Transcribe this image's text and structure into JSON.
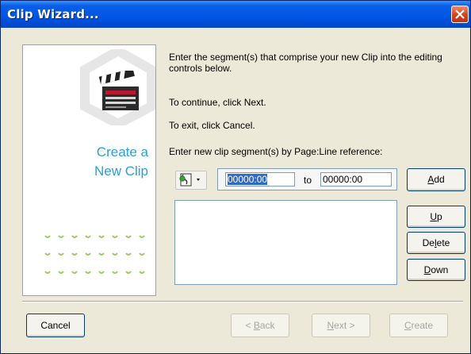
{
  "window": {
    "title": "Clip Wizard..."
  },
  "icons": {
    "close": "close-icon",
    "clapper": "clapperboard-icon",
    "reference": "page-reference-icon",
    "dropdown": "chevron-down-icon"
  },
  "side_panel": {
    "title_line1": "Create a",
    "title_line2": "New Clip",
    "accent_color": "#2a9fd8"
  },
  "instructions": {
    "intro": "Enter the segment(s) that comprise your new Clip into the editing controls below.",
    "continue": "To continue, click Next.",
    "exit": "To exit, click Cancel.",
    "segment_prompt": "Enter new clip segment(s) by Page:Line reference:"
  },
  "segment": {
    "from_value": "00000:00",
    "to_label": "to",
    "to_value": "00000:00"
  },
  "buttons": {
    "add": {
      "pre": "",
      "key": "A",
      "post": "dd"
    },
    "up": {
      "pre": "",
      "key": "U",
      "post": "p"
    },
    "delete": {
      "pre": "De",
      "key": "l",
      "post": "ete"
    },
    "down": {
      "pre": "",
      "key": "D",
      "post": "own"
    },
    "cancel": "Cancel",
    "back": {
      "pre": "< ",
      "key": "B",
      "post": "ack"
    },
    "next": {
      "pre": "",
      "key": "N",
      "post": "ext >"
    },
    "create": {
      "pre": "",
      "key": "C",
      "post": "reate"
    }
  },
  "segments_list": []
}
